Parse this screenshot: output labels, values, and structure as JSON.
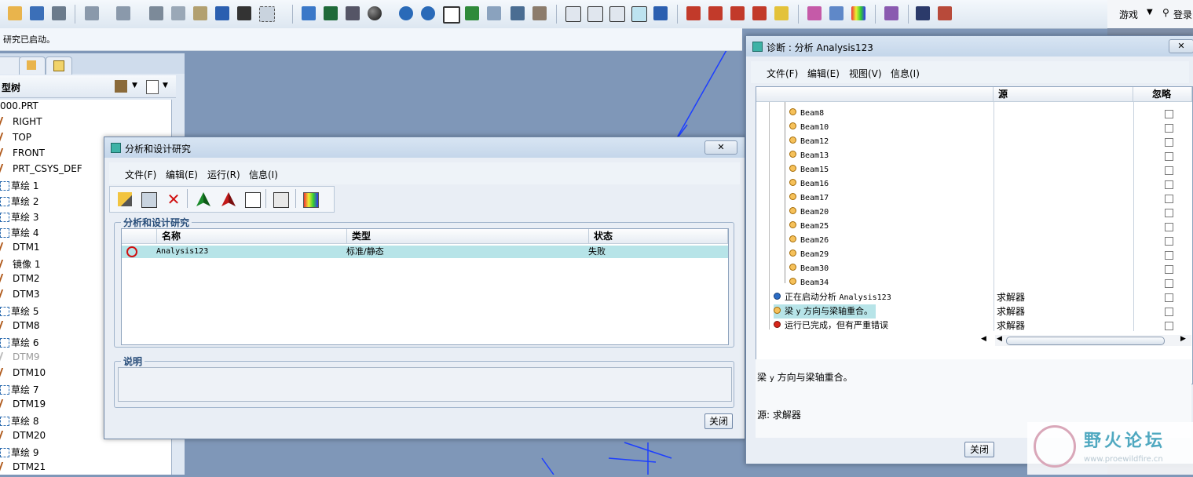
{
  "statusbar": {
    "message": "研究已启动。"
  },
  "topright": {
    "games_label": "游戏",
    "login_label": "登录"
  },
  "model_tree": {
    "title": "型树",
    "items": [
      {
        "label": "000.PRT",
        "kind": "part"
      },
      {
        "label": "RIGHT",
        "kind": "plane"
      },
      {
        "label": "TOP",
        "kind": "plane"
      },
      {
        "label": "FRONT",
        "kind": "plane"
      },
      {
        "label": "PRT_CSYS_DEF",
        "kind": "csys"
      },
      {
        "label": "草绘 1",
        "kind": "sketch"
      },
      {
        "label": "草绘 2",
        "kind": "sketch"
      },
      {
        "label": "草绘 3",
        "kind": "sketch"
      },
      {
        "label": "草绘 4",
        "kind": "sketch"
      },
      {
        "label": "DTM1",
        "kind": "plane"
      },
      {
        "label": "镜像 1",
        "kind": "mirror"
      },
      {
        "label": "DTM2",
        "kind": "plane"
      },
      {
        "label": "DTM3",
        "kind": "plane"
      },
      {
        "label": "草绘 5",
        "kind": "sketch"
      },
      {
        "label": "DTM8",
        "kind": "plane"
      },
      {
        "label": "草绘 6",
        "kind": "sketch"
      },
      {
        "label": "DTM9",
        "kind": "plane",
        "dim": true
      },
      {
        "label": "DTM10",
        "kind": "plane"
      },
      {
        "label": "草绘 7",
        "kind": "sketch"
      },
      {
        "label": "DTM19",
        "kind": "plane"
      },
      {
        "label": "草绘 8",
        "kind": "sketch"
      },
      {
        "label": "DTM20",
        "kind": "plane"
      },
      {
        "label": "草绘 9",
        "kind": "sketch"
      },
      {
        "label": "DTM21",
        "kind": "plane"
      }
    ]
  },
  "analysis_dialog": {
    "title": "分析和设计研究",
    "close_x": "✕",
    "menu": [
      "文件(F)",
      "编辑(E)",
      "运行(R)",
      "信息(I)"
    ],
    "group_title": "分析和设计研究",
    "columns": [
      "名称",
      "类型",
      "状态"
    ],
    "rows": [
      {
        "name": "Analysis123",
        "type": "标准/静态",
        "status": "失败"
      }
    ],
    "desc_title": "说明",
    "close_button": "关闭"
  },
  "diag_dialog": {
    "title": "诊断 : 分析 Analysis123",
    "menu": [
      "文件(F)",
      "编辑(E)",
      "视图(V)",
      "信息(I)"
    ],
    "columns": [
      "源",
      "忽略"
    ],
    "beams": [
      "Beam8",
      "Beam10",
      "Beam12",
      "Beam13",
      "Beam15",
      "Beam16",
      "Beam17",
      "Beam20",
      "Beam25",
      "Beam26",
      "Beam29",
      "Beam30",
      "Beam34"
    ],
    "messages": [
      {
        "prefix": "正在启动分析 ",
        "mono": "Analysis123",
        "source": "求解器",
        "color": "blue"
      },
      {
        "prefix": "梁 ",
        "mono": "y",
        "suffix": " 方向与梁轴重合。",
        "source": "求解器",
        "color": "yellow",
        "selected": true
      },
      {
        "prefix": "运行已完成，但有严重错误",
        "source": "求解器",
        "color": "red"
      }
    ],
    "detail_line1_a": "梁 ",
    "detail_line1_b": "y",
    "detail_line1_c": " 方向与梁轴重合。",
    "detail_line2": "源: 求解器",
    "close_button": "关闭"
  },
  "watermark": {
    "title": "野火论坛",
    "url": "www.proewildfire.cn"
  }
}
